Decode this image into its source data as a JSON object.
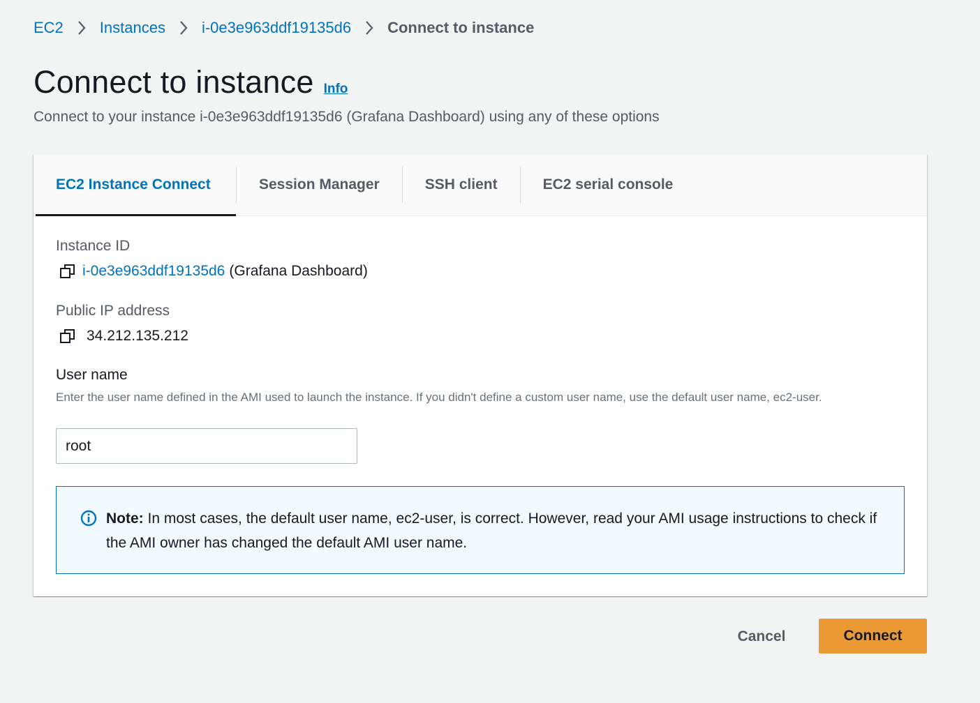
{
  "breadcrumb": {
    "items": [
      "EC2",
      "Instances",
      "i-0e3e963ddf19135d6"
    ],
    "current": "Connect to instance"
  },
  "header": {
    "title": "Connect to instance",
    "info_link": "Info",
    "description": "Connect to your instance i-0e3e963ddf19135d6 (Grafana Dashboard) using any of these options"
  },
  "tabs": [
    {
      "label": "EC2 Instance Connect",
      "active": true
    },
    {
      "label": "Session Manager",
      "active": false
    },
    {
      "label": "SSH client",
      "active": false
    },
    {
      "label": "EC2 serial console",
      "active": false
    }
  ],
  "instance": {
    "label": "Instance ID",
    "id": "i-0e3e963ddf19135d6",
    "name": "(Grafana Dashboard)"
  },
  "public_ip": {
    "label": "Public IP address",
    "value": "34.212.135.212"
  },
  "user_name": {
    "label": "User name",
    "help": "Enter the user name defined in the AMI used to launch the instance. If you didn't define a custom user name, use the default user name, ec2-user.",
    "value": "root"
  },
  "note": {
    "prefix": "Note:",
    "text": " In most cases, the default user name, ec2-user, is correct. However, read your AMI usage instructions to check if the AMI owner has changed the default AMI user name."
  },
  "actions": {
    "cancel": "Cancel",
    "connect": "Connect"
  },
  "colors": {
    "link": "#0073bb",
    "primary_button": "#ec9a35",
    "page_bg": "#f2f3f3",
    "note_bg": "#f1faff"
  },
  "icons": {
    "breadcrumb_separator": "chevron-right-icon",
    "copy": "copy-icon",
    "note": "info-circle-icon"
  }
}
